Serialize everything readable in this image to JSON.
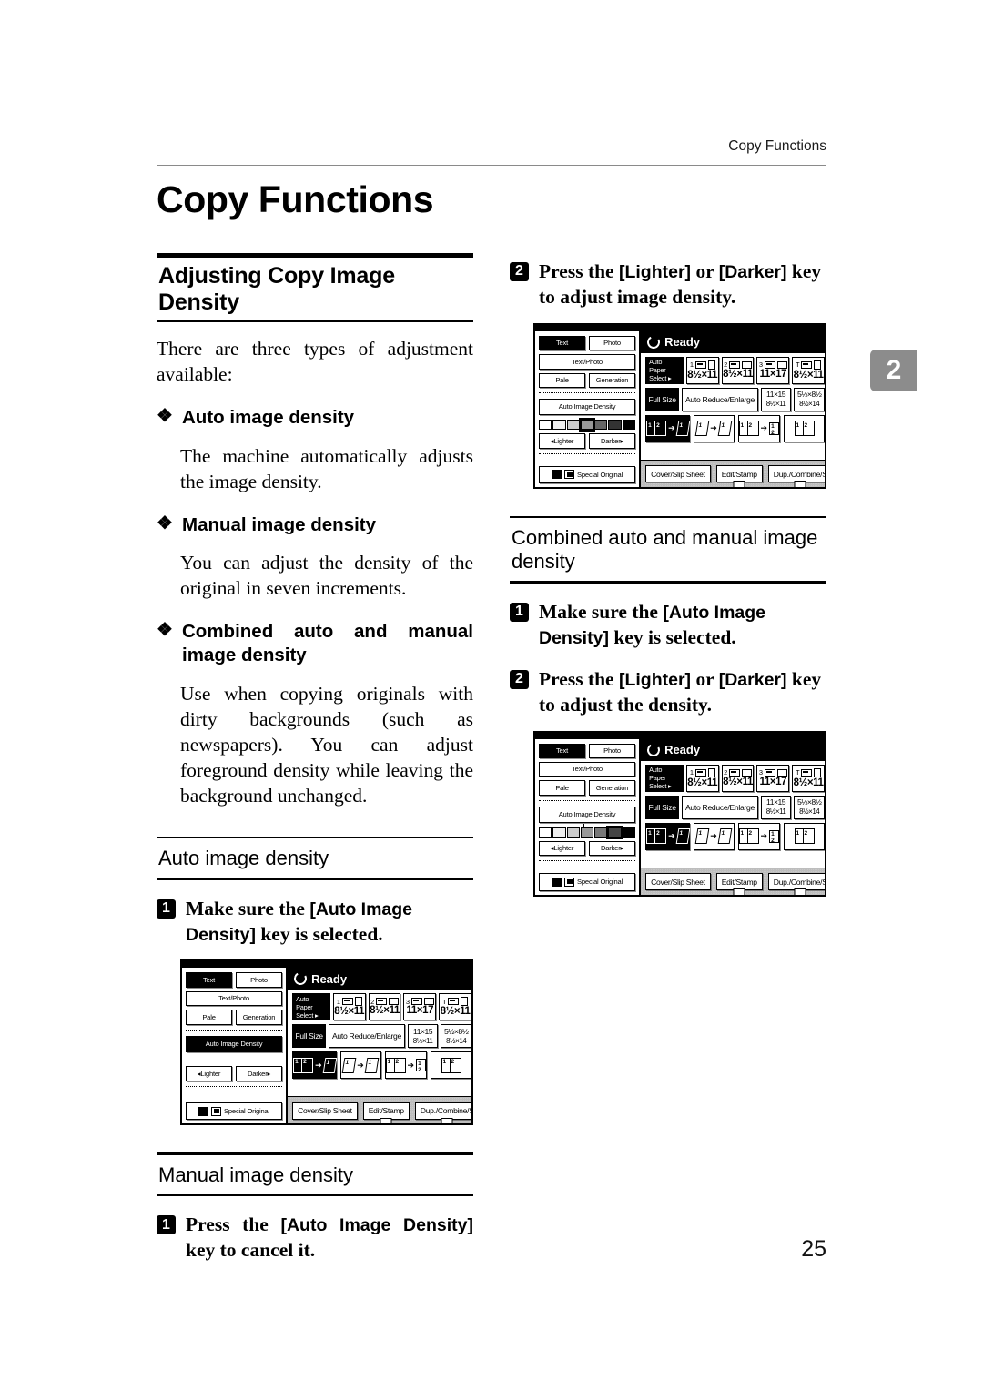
{
  "page": {
    "running_header": "Copy Functions",
    "title": "Copy Functions",
    "chapter_tab": "2",
    "number": "25"
  },
  "left_column": {
    "section_heading": "Adjusting Copy Image Density",
    "intro": "There are three types of adjustment available:",
    "bullets": [
      {
        "glyph": "diamond-bullet",
        "heading": "Auto image density",
        "body": "The machine automatically adjusts the image density."
      },
      {
        "glyph": "diamond-bullet",
        "heading": "Manual image density",
        "body": "You can adjust the density of the original in seven increments."
      },
      {
        "glyph": "diamond-bullet",
        "heading": "Combined auto and manual image density",
        "body": "Use when copying originals with dirty backgrounds (such as newspapers). You can adjust foreground density while leaving the background unchanged."
      }
    ],
    "subsection_auto": {
      "heading": "Auto image density",
      "step1_num": "1",
      "step1_text_before": "Make sure the ",
      "step1_key": "[Auto Image Density]",
      "step1_text_after": " key is selected."
    },
    "subsection_manual": {
      "heading": "Manual image density",
      "step1_num": "1",
      "step1_text_before": "Press the ",
      "step1_key": "[Auto Image Density]",
      "step1_text_after": " key to cancel it."
    }
  },
  "right_column": {
    "step2_num": "2",
    "step2_text_before": "Press the ",
    "step2_key_a": "[Lighter]",
    "step2_mid": " or ",
    "step2_key_b": "[Darker]",
    "step2_text_after": " key to adjust image density.",
    "subsection_combined": {
      "heading": "Combined auto and manual image density",
      "step1_num": "1",
      "step1_text_before": "Make sure the ",
      "step1_key": "[Auto Image Density]",
      "step1_text_after": " key is selected.",
      "step2_num": "2",
      "step2_text_before": "Press the ",
      "step2_key_a": "[Lighter]",
      "step2_mid": " or ",
      "step2_key_b": "[Darker]",
      "step2_text_after": " key to adjust the density."
    }
  },
  "lcd": {
    "status": "Ready",
    "power_icon": "power-ring-icon",
    "rail": {
      "text": "Text",
      "photo": "Photo",
      "text_photo": "Text/Photo",
      "pale": "Pale",
      "generation": "Generation",
      "auto_image_density": "Auto Image Density",
      "lighter": "Lighter",
      "darker": "Darker",
      "special_original": "Special Original"
    },
    "paper_row": {
      "auto_paper_select_line1": "Auto Paper",
      "auto_paper_select_line2": "Select",
      "trays": [
        {
          "num": "1",
          "size": "8½×11",
          "orient": "portrait"
        },
        {
          "num": "2",
          "size": "8½×11",
          "orient": "landscape"
        },
        {
          "num": "3",
          "size": "11×17",
          "orient": "landscape"
        },
        {
          "num": "T",
          "size": "8½×11",
          "orient": "portrait"
        }
      ]
    },
    "zoom_row": {
      "full_size": "Full Size",
      "auto_reduce_enlarge": "Auto Reduce/Enlarge",
      "ratios": [
        {
          "top": "11×15",
          "bottom": "8½×11"
        },
        {
          "top": "5½×8½",
          "bottom": "8½×14"
        }
      ]
    },
    "duplex_row": {
      "buttons": [
        "1-sided-to-2-sided",
        "2-sided-to-2-sided",
        "2-on-1-combine",
        "1-sided"
      ]
    },
    "footer": {
      "cover_slip_sheet": "Cover/Slip Sheet",
      "edit_stamp": "Edit/Stamp",
      "dup_combine": "Dup./Combine/S"
    },
    "density_cells": 7,
    "panels": [
      {
        "id": "panel-auto",
        "auto_density_on": true,
        "density_bar": false,
        "selected_cell": null
      },
      {
        "id": "panel-manual",
        "auto_density_on": false,
        "density_bar": true,
        "selected_cell": 3
      },
      {
        "id": "panel-combined",
        "auto_density_on": false,
        "density_bar": true,
        "selected_cell": 5
      }
    ]
  }
}
